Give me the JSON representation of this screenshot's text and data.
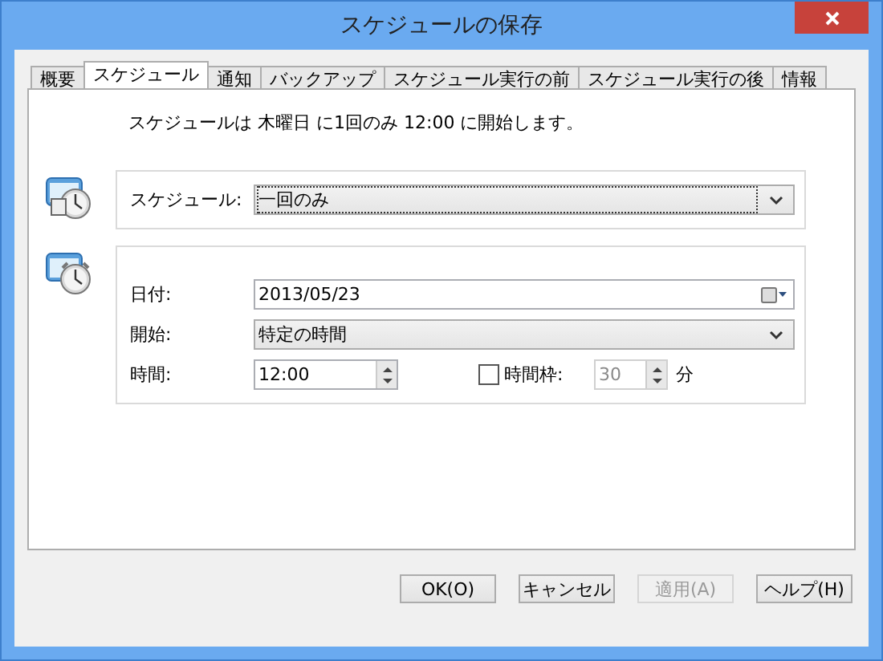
{
  "window": {
    "title": "スケジュールの保存"
  },
  "tabs": [
    {
      "label": "概要",
      "selected": false
    },
    {
      "label": "スケジュール",
      "selected": true
    },
    {
      "label": "通知",
      "selected": false
    },
    {
      "label": "バックアップ",
      "selected": false
    },
    {
      "label": "スケジュール実行の前",
      "selected": false
    },
    {
      "label": "スケジュール実行の後",
      "selected": false
    },
    {
      "label": "情報",
      "selected": false
    }
  ],
  "summary": "スケジュールは 木曜日 に1回のみ 12:00 に開始します。",
  "schedule": {
    "label": "スケジュール:",
    "value": "一回のみ"
  },
  "date": {
    "label": "日付:",
    "value": "2013/05/23"
  },
  "start": {
    "label": "開始:",
    "value": "特定の時間"
  },
  "time": {
    "label": "時間:",
    "value": "12:00"
  },
  "time_window": {
    "label": "時間枠:",
    "checked": false,
    "value": "30",
    "disabled": true,
    "unit": "分"
  },
  "buttons": [
    {
      "label": "OK(O)",
      "disabled": false
    },
    {
      "label": "キャンセル",
      "disabled": false
    },
    {
      "label": "適用(A)",
      "disabled": true
    },
    {
      "label": "ヘルプ(H)",
      "disabled": false
    }
  ]
}
